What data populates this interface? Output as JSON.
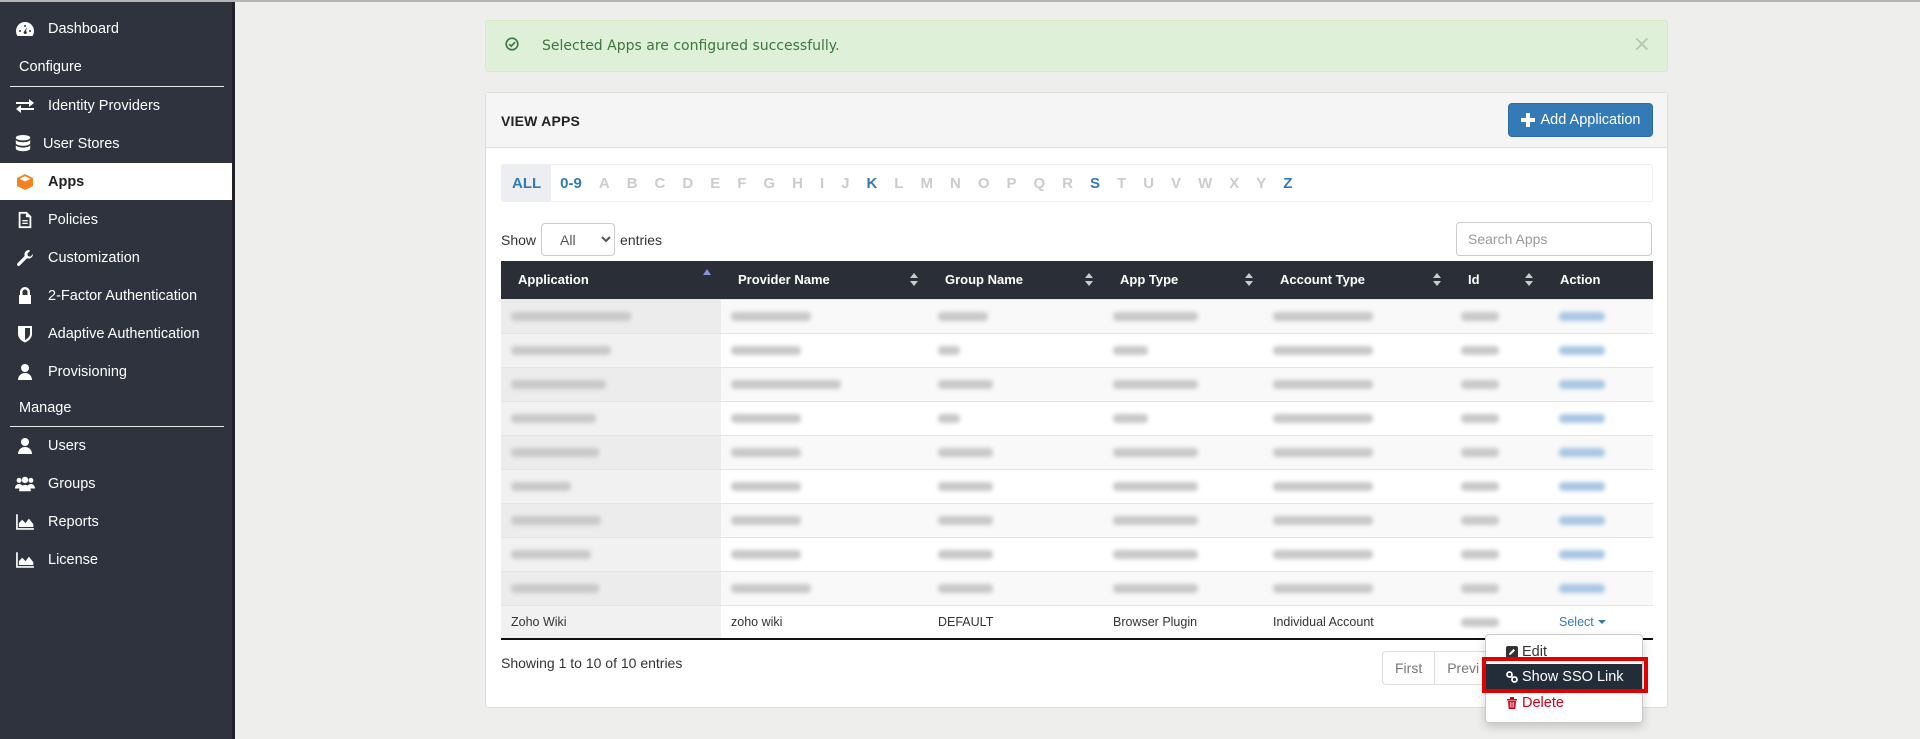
{
  "sidebar": {
    "items": [
      {
        "label": "Dashboard",
        "icon": "dashboard-icon"
      },
      {
        "label": "Identity Providers",
        "icon": "exchange-icon"
      },
      {
        "label": "User Stores",
        "icon": "database-icon"
      },
      {
        "label": "Apps",
        "icon": "cube-icon",
        "active": true
      },
      {
        "label": "Policies",
        "icon": "document-icon"
      },
      {
        "label": "Customization",
        "icon": "wrench-icon"
      },
      {
        "label": "2-Factor Authentication",
        "icon": "lock-icon"
      },
      {
        "label": "Adaptive Authentication",
        "icon": "shield-icon"
      },
      {
        "label": "Provisioning",
        "icon": "user-icon"
      },
      {
        "label": "Users",
        "icon": "user-icon"
      },
      {
        "label": "Groups",
        "icon": "users-icon"
      },
      {
        "label": "Reports",
        "icon": "area-chart-icon"
      },
      {
        "label": "License",
        "icon": "area-chart-icon"
      }
    ],
    "sections": {
      "configure": "Configure",
      "manage": "Manage"
    }
  },
  "alert": {
    "message": "Selected Apps are configured successfully.",
    "close": "×",
    "color": "#3c763d"
  },
  "panel": {
    "title": "VIEW APPS",
    "add_button": "Add Application"
  },
  "alphabet": [
    "ALL",
    "0-9",
    "A",
    "B",
    "C",
    "D",
    "E",
    "F",
    "G",
    "H",
    "I",
    "J",
    "K",
    "L",
    "M",
    "N",
    "O",
    "P",
    "Q",
    "R",
    "S",
    "T",
    "U",
    "V",
    "W",
    "X",
    "Y",
    "Z"
  ],
  "alphabet_active": [
    "ALL",
    "0-9",
    "K",
    "S",
    "Z"
  ],
  "alphabet_selected": "ALL",
  "entries": {
    "show": "Show",
    "value": "All",
    "suffix": "entries"
  },
  "search": {
    "placeholder": "Search Apps"
  },
  "table": {
    "columns": [
      "Application",
      "Provider Name",
      "Group Name",
      "App Type",
      "Account Type",
      "Id",
      "Action"
    ],
    "rows": [
      {
        "app": "",
        "provider": "",
        "group": "",
        "type": "",
        "account": "",
        "id": "",
        "action": "Select",
        "blurred": true
      },
      {
        "app": "",
        "provider": "",
        "group": "",
        "type": "",
        "account": "",
        "id": "",
        "action": "Select",
        "blurred": true
      },
      {
        "app": "",
        "provider": "",
        "group": "",
        "type": "",
        "account": "",
        "id": "",
        "action": "Select",
        "blurred": true
      },
      {
        "app": "",
        "provider": "",
        "group": "",
        "type": "",
        "account": "",
        "id": "",
        "action": "Select",
        "blurred": true
      },
      {
        "app": "",
        "provider": "",
        "group": "",
        "type": "",
        "account": "",
        "id": "",
        "action": "Select",
        "blurred": true
      },
      {
        "app": "",
        "provider": "",
        "group": "",
        "type": "",
        "account": "",
        "id": "",
        "action": "Select",
        "blurred": true
      },
      {
        "app": "",
        "provider": "",
        "group": "",
        "type": "",
        "account": "",
        "id": "",
        "action": "Select",
        "blurred": true
      },
      {
        "app": "",
        "provider": "",
        "group": "",
        "type": "",
        "account": "",
        "id": "",
        "action": "Select",
        "blurred": true
      },
      {
        "app": "",
        "provider": "",
        "group": "",
        "type": "",
        "account": "",
        "id": "",
        "action": "Select",
        "blurred": true
      },
      {
        "app": "Zoho Wiki",
        "provider": "zoho wiki",
        "group": "DEFAULT",
        "type": "Browser Plugin",
        "account": "Individual Account",
        "id": "",
        "action": "Select",
        "blurred": false
      }
    ]
  },
  "info": "Showing 1 to 10 of 10 entries",
  "pager": [
    "First",
    "Previ"
  ],
  "dropdown": {
    "edit": "Edit",
    "sso": "Show SSO Link",
    "delete": "Delete"
  },
  "colors": {
    "accent": "#337ab7",
    "sidebar": "#2e333d",
    "active_icon": "#f58220",
    "danger": "#d0021b",
    "highlight": "#e00000"
  }
}
